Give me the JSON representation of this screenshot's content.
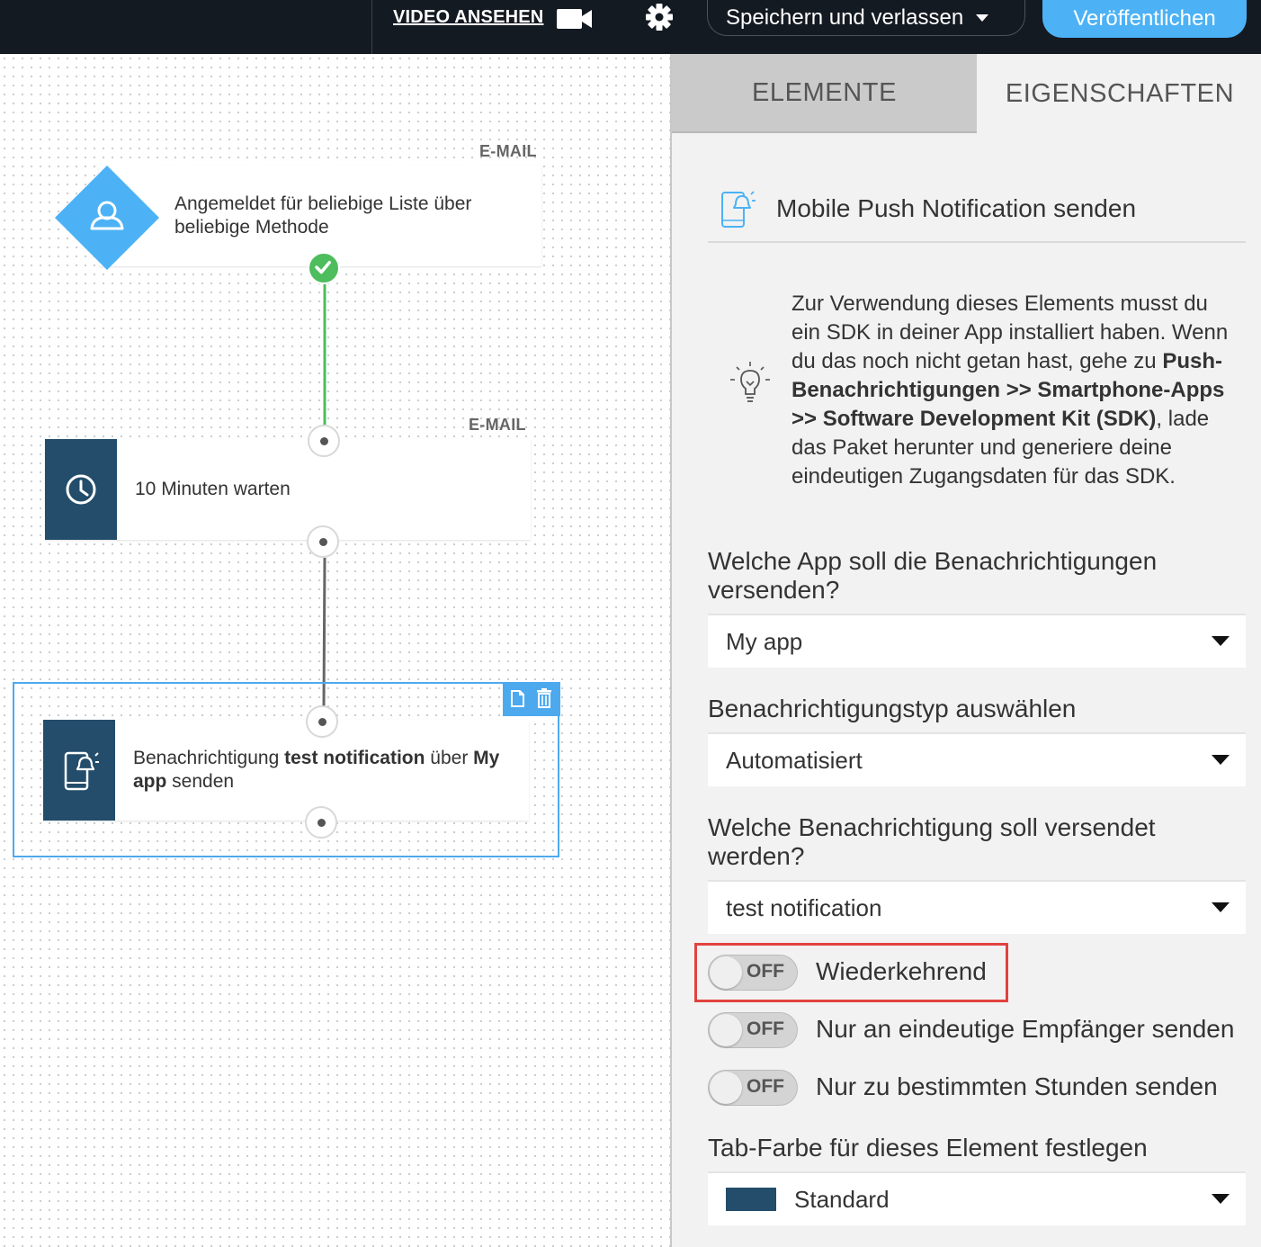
{
  "topbar": {
    "video_label": "VIDEO ANSEHEN",
    "save_label": "Speichern und verlassen",
    "publish_label": "Veröffentlichen"
  },
  "canvas": {
    "nodes": [
      {
        "badge": "E-MAIL",
        "text": "Angemeldet für beliebige Liste über beliebige Methode",
        "icon": "user-icon"
      },
      {
        "badge": "E-MAIL",
        "text": "10 Minuten warten",
        "icon": "clock-icon"
      },
      {
        "text_before": "Benachrichtigung ",
        "text_bold_1": "test notification",
        "text_mid": " über ",
        "text_bold_2": "My app",
        "text_after": " senden",
        "icon": "mobile-push-icon"
      }
    ]
  },
  "panel": {
    "tabs": [
      "ELEMENTE",
      "EIGENSCHAFTEN"
    ],
    "title": "Mobile Push Notification senden",
    "info": {
      "part1": "Zur Verwendung dieses Elements musst du ein SDK in deiner App installiert haben. Wenn du das noch nicht getan hast, gehe zu ",
      "bold": "Push-Benachrichtigungen >> Smartphone-Apps >> Software Development Kit (SDK)",
      "part2": ", lade das Paket herunter und generiere deine eindeutigen Zugangsdaten für das SDK."
    },
    "fields": [
      {
        "label": "Welche App soll die Benachrichtigungen versenden?",
        "value": "My app"
      },
      {
        "label": "Benachrichtigungstyp auswählen",
        "value": "Automatisiert"
      },
      {
        "label": "Welche Benachrichtigung soll versendet werden?",
        "value": "test notification"
      }
    ],
    "toggles": [
      {
        "state": "OFF",
        "label": "Wiederkehrend"
      },
      {
        "state": "OFF",
        "label": "Nur an eindeutige Empfänger senden"
      },
      {
        "state": "OFF",
        "label": "Nur zu bestimmten Stunden senden"
      }
    ],
    "tab_color": {
      "label": "Tab-Farbe für dieses Element festlegen",
      "value": "Standard",
      "swatch": "#234d6b"
    }
  },
  "colors": {
    "accent": "#4cb2f5",
    "dark_node": "#234d6b",
    "success": "#4dbd5d",
    "highlight": "#e2423f"
  }
}
